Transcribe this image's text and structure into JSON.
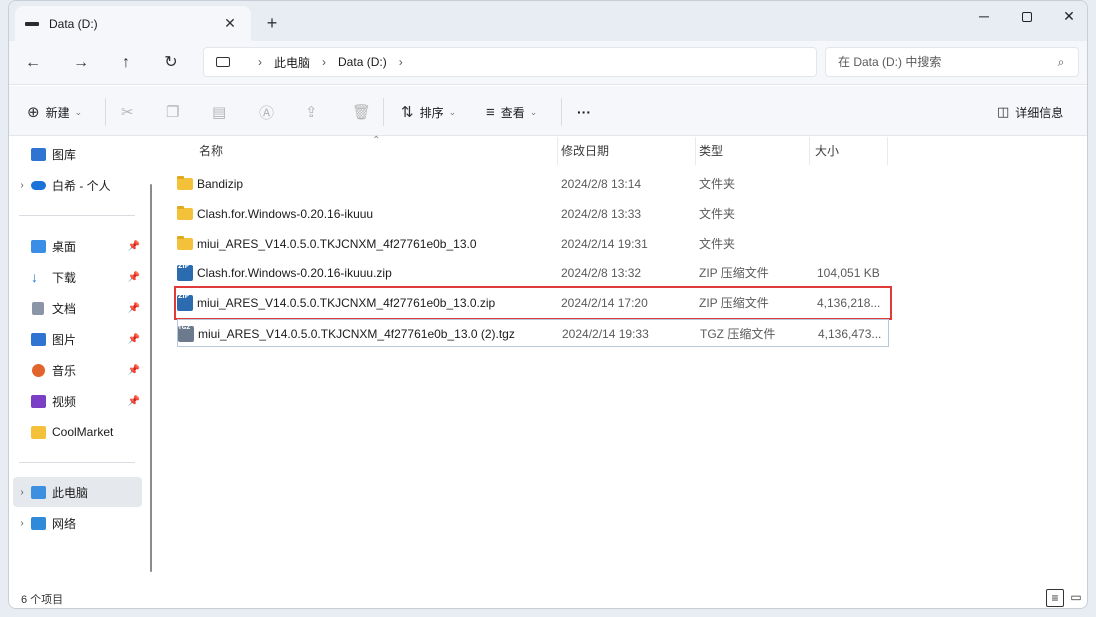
{
  "tab": {
    "title": "Data (D:)",
    "close_glyph": "✕",
    "new_tab_glyph": "+"
  },
  "window_controls": {
    "minimize": "─",
    "close": "✕"
  },
  "nav": {
    "back": "←",
    "forward": "→",
    "up": "↑",
    "refresh": "↻"
  },
  "breadcrumb": {
    "sep": "›",
    "items": [
      "此电脑",
      "Data (D:)"
    ]
  },
  "search": {
    "placeholder": "在 Data (D:) 中搜索",
    "icon": "search-icon"
  },
  "commands": {
    "new": "新建",
    "sort": "排序",
    "view": "查看",
    "more": "···",
    "details_pane": "详细信息"
  },
  "sidebar": {
    "items": [
      {
        "label": "图库",
        "icon": "gallery-icon"
      },
      {
        "label": "白希 - 个人",
        "icon": "onedrive-cloud-icon"
      },
      {
        "label": "桌面",
        "icon": "desktop-icon"
      },
      {
        "label": "下载",
        "icon": "download-icon"
      },
      {
        "label": "文档",
        "icon": "documents-icon"
      },
      {
        "label": "图片",
        "icon": "pictures-icon"
      },
      {
        "label": "音乐",
        "icon": "music-icon"
      },
      {
        "label": "视频",
        "icon": "videos-icon"
      },
      {
        "label": "CoolMarket",
        "icon": "folder-icon"
      },
      {
        "label": "此电脑",
        "icon": "this-pc-icon"
      },
      {
        "label": "网络",
        "icon": "network-icon"
      }
    ]
  },
  "columns": {
    "name": "名称",
    "date": "修改日期",
    "type": "类型",
    "size": "大小"
  },
  "files": [
    {
      "name": "Bandizip",
      "date": "2024/2/8 13:14",
      "type": "文件夹",
      "size": "",
      "kind": "folder"
    },
    {
      "name": "Clash.for.Windows-0.20.16-ikuuu",
      "date": "2024/2/8 13:33",
      "type": "文件夹",
      "size": "",
      "kind": "folder"
    },
    {
      "name": "miui_ARES_V14.0.5.0.TKJCNXM_4f27761e0b_13.0",
      "date": "2024/2/14 19:31",
      "type": "文件夹",
      "size": "",
      "kind": "folder"
    },
    {
      "name": "Clash.for.Windows-0.20.16-ikuuu.zip",
      "date": "2024/2/8 13:32",
      "type": "ZIP 压缩文件",
      "size": "104,051 KB",
      "kind": "zip"
    },
    {
      "name": "miui_ARES_V14.0.5.0.TKJCNXM_4f27761e0b_13.0.zip",
      "date": "2024/2/14 17:20",
      "type": "ZIP 压缩文件",
      "size": "4,136,218...",
      "kind": "zip"
    },
    {
      "name": "miui_ARES_V14.0.5.0.TKJCNXM_4f27761e0b_13.0 (2).tgz",
      "date": "2024/2/14 19:33",
      "type": "TGZ 压缩文件",
      "size": "4,136,473...",
      "kind": "tgz"
    }
  ],
  "status": {
    "count": "6 个项目"
  },
  "colors": {
    "highlight_border": "#e03b3b",
    "folder": "#f3c13a",
    "accent": "#0067c0"
  }
}
